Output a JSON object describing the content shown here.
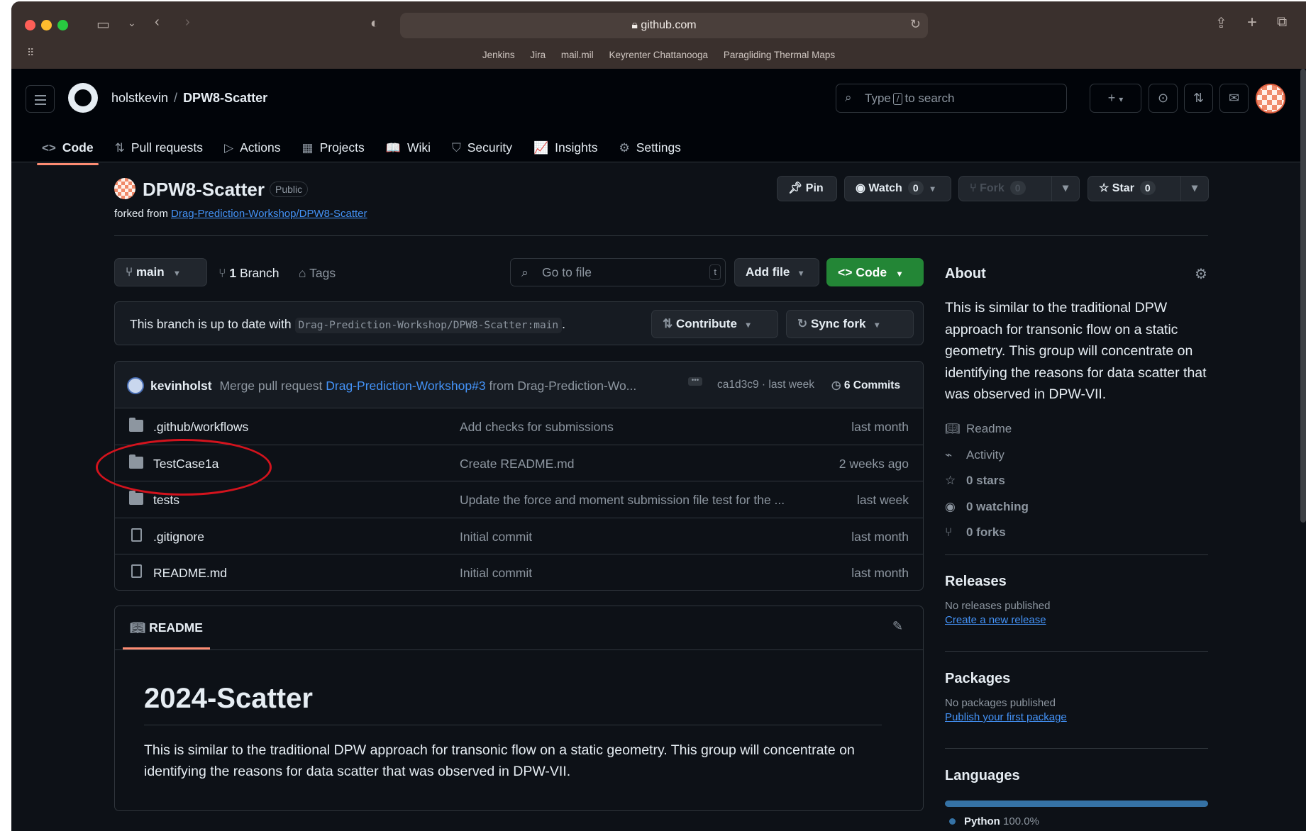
{
  "browser": {
    "url": "github.com",
    "bookmarks": [
      "Jenkins",
      "Jira",
      "mail.mil",
      "Keyrenter Chattanooga",
      "Paragliding Thermal Maps"
    ]
  },
  "header": {
    "owner": "holstkevin",
    "separator": "/",
    "repo": "DPW8-Scatter",
    "search_prefix": "Type",
    "search_key": "/",
    "search_suffix": "to search",
    "plus": "+"
  },
  "nav": [
    {
      "label": "Code",
      "icon": "code-icon",
      "glyph": "<>"
    },
    {
      "label": "Pull requests",
      "icon": "pull-request-icon",
      "glyph": "⇅"
    },
    {
      "label": "Actions",
      "icon": "play-icon",
      "glyph": "▷"
    },
    {
      "label": "Projects",
      "icon": "table-icon",
      "glyph": "▦"
    },
    {
      "label": "Wiki",
      "icon": "book-icon",
      "glyph": "📖"
    },
    {
      "label": "Security",
      "icon": "shield-icon",
      "glyph": "⛉"
    },
    {
      "label": "Insights",
      "icon": "graph-icon",
      "glyph": "📈"
    },
    {
      "label": "Settings",
      "icon": "gear-icon",
      "glyph": "⚙"
    }
  ],
  "repo": {
    "title": "DPW8-Scatter",
    "visibility": "Public",
    "forked_prefix": "forked from",
    "forked_link": "Drag-Prediction-Workshop/DPW8-Scatter",
    "pin": "Pin",
    "watch": "Watch",
    "watch_count": "0",
    "fork": "Fork",
    "fork_count": "0",
    "star": "Star",
    "star_count": "0"
  },
  "toolbar": {
    "branch": "main",
    "branch_count": "1",
    "branch_label": "Branch",
    "tags": "Tags",
    "goto_placeholder": "Go to file",
    "goto_key": "t",
    "add_file": "Add file",
    "code": "Code"
  },
  "branch_status": {
    "text": "This branch is up to date with",
    "ref": "Drag-Prediction-Workshop/DPW8-Scatter:main",
    "period": ".",
    "contribute": "Contribute",
    "sync": "Sync fork"
  },
  "commit": {
    "author": "kevinholst",
    "msg_prefix": "Merge pull request",
    "pr_link": "Drag-Prediction-Workshop#3",
    "msg_suffix": "from Drag-Prediction-Wo...",
    "hash_time": "ca1d3c9 · last week",
    "commits": "6 Commits"
  },
  "files": [
    {
      "name": ".github/workflows",
      "type": "folder",
      "message": "Add checks for submissions",
      "date": "last month"
    },
    {
      "name": "TestCase1a",
      "type": "folder",
      "message": "Create README.md",
      "date": "2 weeks ago"
    },
    {
      "name": "tests",
      "type": "folder",
      "message": "Update the force and moment submission file test for the ...",
      "date": "last week"
    },
    {
      "name": ".gitignore",
      "type": "file",
      "message": "Initial commit",
      "date": "last month"
    },
    {
      "name": "README.md",
      "type": "file",
      "message": "Initial commit",
      "date": "last month"
    }
  ],
  "readme": {
    "tab": "README",
    "heading": "2024-Scatter",
    "body": "This is similar to the traditional DPW approach for transonic flow on a static geometry. This group will concentrate on identifying the reasons for data scatter that was observed in DPW-VII."
  },
  "about": {
    "title": "About",
    "description": "This is similar to the traditional DPW approach for transonic flow on a static geometry. This group will concentrate on identifying the reasons for data scatter that was observed in DPW-VII.",
    "readme": "Readme",
    "activity": "Activity",
    "stars": "0 stars",
    "watching": "0 watching",
    "forks": "0 forks"
  },
  "releases": {
    "title": "Releases",
    "none": "No releases published",
    "link": "Create a new release"
  },
  "packages": {
    "title": "Packages",
    "none": "No packages published",
    "link": "Publish your first package"
  },
  "languages": {
    "title": "Languages",
    "items": [
      {
        "name": "Python",
        "percent": "100.0%",
        "color": "#3572a5"
      }
    ]
  }
}
